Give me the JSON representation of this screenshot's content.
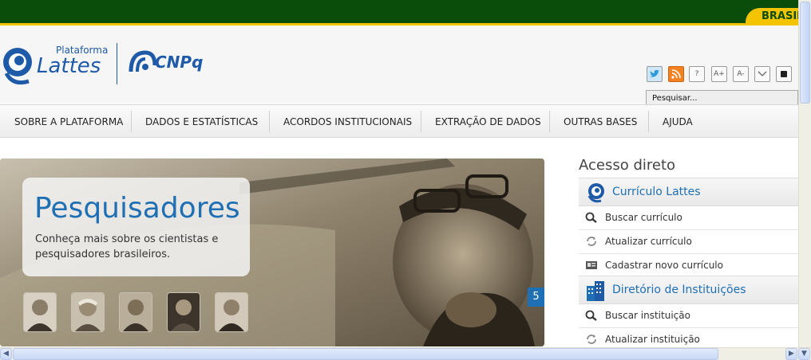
{
  "gov_bar": {
    "badge": "BRASIL"
  },
  "header": {
    "logo_small": "Plataforma",
    "logo_main": "Lattes",
    "partner_logo": "CNPq",
    "tools": [
      "twitter-icon",
      "rss-icon",
      "?",
      "A+",
      "A-",
      "chevron-down-icon",
      "contrast-icon"
    ],
    "search_placeholder": "Pesquisar..."
  },
  "nav": {
    "items": [
      "SOBRE A PLATAFORMA",
      "DADOS E ESTATÍSTICAS",
      "ACORDOS INSTITUCIONAIS",
      "EXTRAÇÃO DE DADOS",
      "OUTRAS BASES",
      "AJUDA"
    ]
  },
  "slider": {
    "title": "Pesquisadores",
    "text": "Conheça mais sobre os cientistas e pesquisadores brasileiros.",
    "slide_number": "5"
  },
  "sidebar": {
    "title": "Acesso direto",
    "sections": [
      {
        "title": "Currículo Lattes",
        "icon": "lattes-logo-icon",
        "items": [
          {
            "label": "Buscar currículo",
            "icon": "magnifier-icon"
          },
          {
            "label": "Atualizar currículo",
            "icon": "refresh-icon"
          },
          {
            "label": "Cadastrar novo currículo",
            "icon": "id-card-icon"
          }
        ]
      },
      {
        "title": "Diretório de Instituições",
        "icon": "building-icon",
        "items": [
          {
            "label": "Buscar instituição",
            "icon": "magnifier-icon"
          },
          {
            "label": "Atualizar instituição",
            "icon": "refresh-icon"
          }
        ]
      }
    ]
  },
  "colors": {
    "gov_green": "#0a4d0a",
    "gov_yellow": "#f4c400",
    "brand_blue": "#1e6fb3"
  }
}
